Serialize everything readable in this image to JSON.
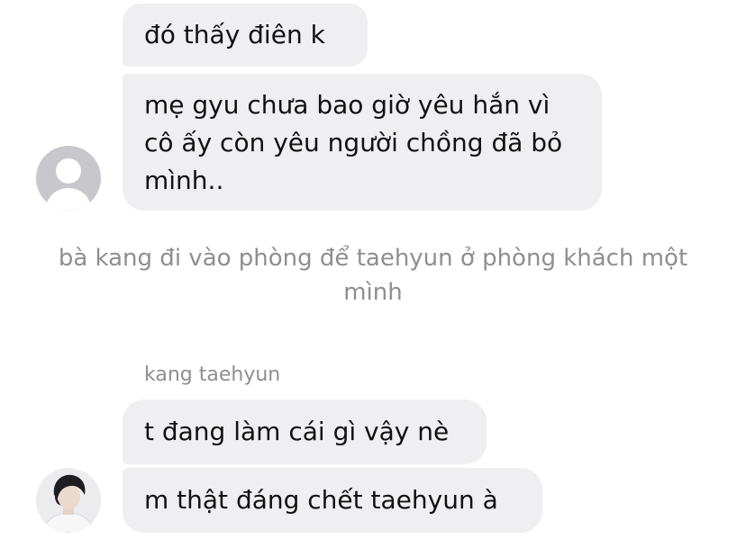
{
  "thread": {
    "group1": {
      "messages": [
        {
          "text": "đó thấy điên k"
        },
        {
          "text": "mẹ gyu chưa bao giờ yêu hắn vì cô ấy còn yêu người chồng đã bỏ mình.."
        }
      ]
    },
    "system_note": "bà kang đi vào phòng để taehyun ở phòng khách một mình",
    "group2": {
      "sender_name": "kang taehyun",
      "messages": [
        {
          "text": "t đang làm cái gì vậy nè"
        },
        {
          "text": "m thật đáng chết taehyun à"
        }
      ]
    }
  },
  "colors": {
    "bubble_background": "#efeff1",
    "secondary_text": "#8e8e93",
    "avatar_placeholder": "#c7c7cc"
  },
  "icons": {
    "placeholder_avatar": "default-user-avatar-icon",
    "photo_avatar": "user-photo-avatar"
  }
}
